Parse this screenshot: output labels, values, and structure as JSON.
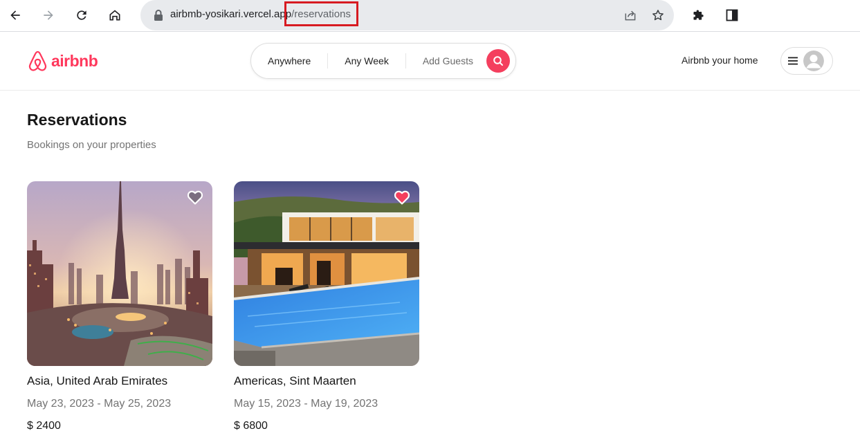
{
  "browser": {
    "url_host": "airbmb-yosikari.vercel.app",
    "url_path": "/reservations",
    "icons": [
      "back-arrow-icon",
      "forward-arrow-icon",
      "reload-icon",
      "home-icon",
      "lock-icon",
      "share-icon",
      "star-icon",
      "extensions-icon",
      "side-panel-icon"
    ]
  },
  "header": {
    "logo_text": "airbnb",
    "search": {
      "where": "Anywhere",
      "when": "Any Week",
      "guests": "Add Guests"
    },
    "host_link": "Airbnb your home"
  },
  "page": {
    "title": "Reservations",
    "subtitle": "Bookings on your properties"
  },
  "listings": [
    {
      "location": "Asia, United Arab Emirates",
      "dates": "May 23, 2023 - May 25, 2023",
      "price": "$ 2400",
      "favorited": false,
      "image": "city-skyline-photo"
    },
    {
      "location": "Americas, Sint Maarten",
      "dates": "May 15, 2023 - May 19, 2023",
      "price": "$ 6800",
      "favorited": true,
      "image": "villa-pool-photo"
    }
  ],
  "colors": {
    "brand": "#ff385c",
    "search_button": "#f43f5e",
    "url_highlight": "#d71a21"
  }
}
